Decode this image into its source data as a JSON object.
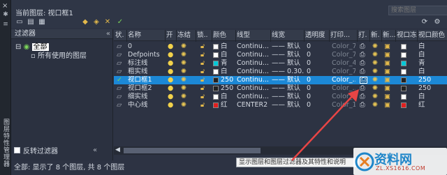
{
  "left_bar": {
    "close": "×",
    "vertical_title": "图层特性管理器"
  },
  "header": {
    "current_layer": "当前图层: 视口框1",
    "search_placeholder": "搜索图层"
  },
  "toolbar": [
    "new-filter-icon",
    "group-filter-icon",
    "layer-state-icon",
    "new-layer-icon",
    "new-layer-vp-icon",
    "delete-layer-icon",
    "set-current-icon"
  ],
  "filter": {
    "title": "过滤器",
    "collapse": "«",
    "root": "全部",
    "child": "所有使用的图层",
    "invert_label": "反转过滤器",
    "invert_collapse": "«"
  },
  "columns": [
    "状.",
    "名称",
    "开",
    "冻结",
    "锁..",
    "颜色",
    "线型",
    "线宽",
    "透明度",
    "打印...",
    "打.",
    "新.",
    "新...",
    "视口冻结",
    "视口颜色"
  ],
  "rows": [
    {
      "name": "0",
      "color_name": "白",
      "color": "#ffffff",
      "linetype": "Continu...",
      "lineweight": "—— 默认",
      "transparency": "0",
      "plot": "Color_7",
      "vp_color_name": "白",
      "vp_color": "#ffffff",
      "selected": false,
      "current": false
    },
    {
      "name": "Defpoints",
      "color_name": "白",
      "color": "#ffffff",
      "linetype": "Continu...",
      "lineweight": "—— 默认",
      "transparency": "0",
      "plot": "Color_7",
      "vp_color_name": "白",
      "vp_color": "#ffffff",
      "selected": false,
      "current": false
    },
    {
      "name": "标注线",
      "color_name": "青",
      "color": "#00c8d8",
      "linetype": "Continu...",
      "lineweight": "—— 默认",
      "transparency": "0",
      "plot": "Color_4",
      "vp_color_name": "青",
      "vp_color": "#00c8d8",
      "selected": false,
      "current": false
    },
    {
      "name": "粗实线",
      "color_name": "白",
      "color": "#ffffff",
      "linetype": "Continu...",
      "lineweight": "—— 0.30...",
      "transparency": "0",
      "plot": "Color_7",
      "vp_color_name": "白",
      "vp_color": "#ffffff",
      "selected": false,
      "current": false
    },
    {
      "name": "视口框1",
      "color_name": "250",
      "color": "#222222",
      "linetype": "Continu...",
      "lineweight": "—— 默认",
      "transparency": "0",
      "plot": "Color_...",
      "vp_color_name": "250",
      "vp_color": "#222222",
      "selected": true,
      "current": true
    },
    {
      "name": "视口框2",
      "color_name": "250",
      "color": "#222222",
      "linetype": "Continu...",
      "lineweight": "—— 默认",
      "transparency": "0",
      "plot": "Color_...",
      "vp_color_name": "250",
      "vp_color": "#222222",
      "selected": false,
      "current": false
    },
    {
      "name": "细实线",
      "color_name": "白",
      "color": "#ffffff",
      "linetype": "Continu...",
      "lineweight": "—— 默认",
      "transparency": "0",
      "plot": "Color_7",
      "vp_color_name": "白",
      "vp_color": "#ffffff",
      "selected": false,
      "current": false
    },
    {
      "name": "中心线",
      "color_name": "红",
      "color": "#e02020",
      "linetype": "CENTER2",
      "lineweight": "—— 默认",
      "transparency": "0",
      "plot": "Color_1",
      "vp_color_name": "红",
      "vp_color": "#e02020",
      "selected": false,
      "current": false
    }
  ],
  "scroll": {
    "left_arrow": "◀"
  },
  "status": "全部: 显示了 8 个图层, 共 8 个图层",
  "tooltip": "显示图层和图层过滤器及其特性和说明",
  "watermark": {
    "title": "资料网",
    "url": "ZL.XS1616.COM"
  }
}
